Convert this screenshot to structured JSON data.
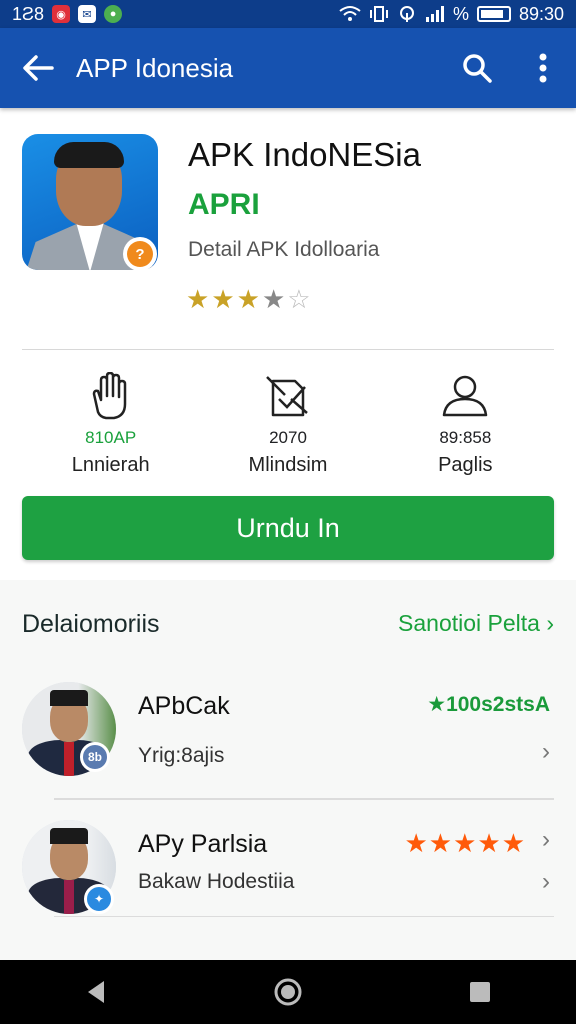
{
  "status_bar": {
    "left_text": "1Ƨ8",
    "right_text": "89:30",
    "percent": "%"
  },
  "app_bar": {
    "title": "APP Idonesia"
  },
  "app": {
    "name": "APK IndoNESia",
    "developer": "APRI",
    "subtitle": "Detail APK Idolloaria",
    "rating": 3.5,
    "icon_badge": "?"
  },
  "stats": [
    {
      "value": "810AP",
      "label": "Lnnierah",
      "value_color": "#1aa13c",
      "icon": "hand-icon"
    },
    {
      "value": "2070",
      "label": "Mlindsim",
      "value_color": "#222222",
      "icon": "install-icon"
    },
    {
      "value": "89:858",
      "label": "Paglis",
      "value_color": "#222222",
      "icon": "user-icon"
    }
  ],
  "install_label": "Urndu In",
  "section": {
    "title": "Delaiomoriis",
    "link": "Sanotioi Pelta ›"
  },
  "items": [
    {
      "title": "APbCak",
      "subtitle": "Yrig:8ajis",
      "rating_text": "★100s2stsA",
      "badge": "8b",
      "badge_color": "#5a7bb0"
    },
    {
      "title": "APy Parlsia",
      "subtitle": "Bakaw Hodestiia",
      "stars": "★★★★★",
      "badge": "✦",
      "badge_color": "#2a8ae0"
    }
  ],
  "colors": {
    "status_bar": "#0d3d8a",
    "app_bar": "#1652b0",
    "accent_green": "#1ea142",
    "star_orange": "#ff5a0a",
    "star_gold": "#c9a227"
  }
}
